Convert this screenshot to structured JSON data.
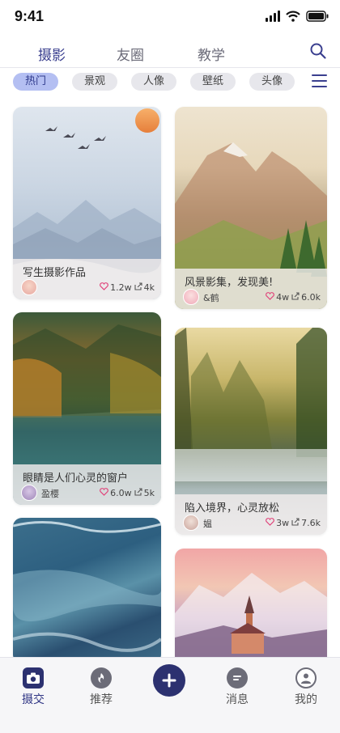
{
  "status": {
    "time": "9:41"
  },
  "top_tabs": [
    {
      "label": "摄影",
      "active": true
    },
    {
      "label": "友圈",
      "active": false
    },
    {
      "label": "教学",
      "active": false
    }
  ],
  "chips": [
    {
      "label": "热门",
      "active": true
    },
    {
      "label": "景观",
      "active": false
    },
    {
      "label": "人像",
      "active": false
    },
    {
      "label": "壁纸",
      "active": false
    },
    {
      "label": "头像",
      "active": false
    }
  ],
  "cards": [
    {
      "title": "写生摄影作品",
      "author": "",
      "likes": "1.2w",
      "shares": "4k"
    },
    {
      "title": "风景影集，发现美!",
      "author": "&鹤",
      "likes": "4w",
      "shares": "6.0k"
    },
    {
      "title": "眼睛是人们心灵的窗户",
      "author": "盈樱",
      "likes": "6.0w",
      "shares": "5k"
    },
    {
      "title": "陷入境界，心灵放松",
      "author": "媪",
      "likes": "3w",
      "shares": "7.6k"
    }
  ],
  "bottom_nav": [
    {
      "label": "摄交",
      "icon": "camera-icon",
      "active": true
    },
    {
      "label": "推荐",
      "icon": "recommend-icon",
      "active": false
    },
    {
      "label": "",
      "icon": "add-icon",
      "active": false
    },
    {
      "label": "消息",
      "icon": "message-icon",
      "active": false
    },
    {
      "label": "我的",
      "icon": "profile-icon",
      "active": false
    }
  ],
  "colors": {
    "accent": "#2c3170",
    "chip_active": "#b4bff2",
    "heart": "#e0457b"
  }
}
